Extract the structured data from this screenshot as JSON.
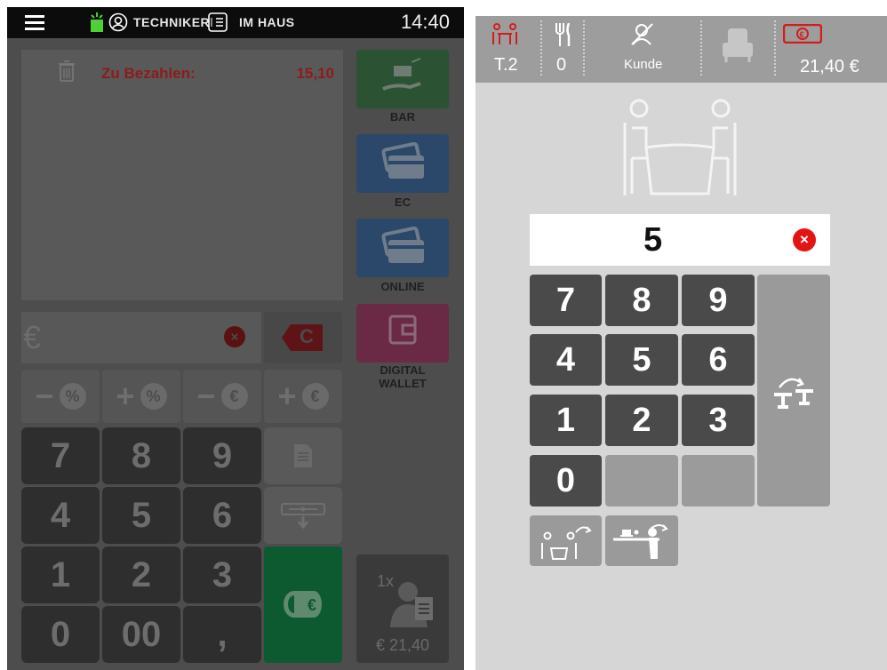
{
  "topbar": {
    "user_label": "TECHNIKER",
    "location_label": "IM HAUS",
    "time": "14:40",
    "icons": [
      "menu-icon",
      "alarm-icon",
      "user-icon",
      "list-icon"
    ]
  },
  "payment": {
    "due_label": "Zu Bezahlen:",
    "due_value": "15,10",
    "currency_symbol": "€",
    "clear_label": "C",
    "methods": [
      {
        "label": "BAR",
        "color": "#2a5e36",
        "icon": "cash-hand-icon"
      },
      {
        "label": "EC",
        "color": "#2b4d77",
        "icon": "card-icon"
      },
      {
        "label": "ONLINE",
        "color": "#2b4d77",
        "icon": "card-icon"
      },
      {
        "label": "DIGITAL WALLET",
        "color": "#7b2a4d",
        "icon": "wallet-icon"
      }
    ],
    "modifiers": [
      "%",
      "%",
      "€",
      "€"
    ],
    "modifier_signs": [
      "−",
      "+",
      "−",
      "+"
    ],
    "keys": [
      "7",
      "8",
      "9",
      "4",
      "5",
      "6",
      "1",
      "2",
      "3",
      "0",
      "00",
      ","
    ],
    "customer_count": "1x",
    "customer_total": "€ 21,40",
    "colors": {
      "due": "#b11b1b",
      "pay_green": "#0e6c3a",
      "clear_red": "#a3161b"
    }
  },
  "header": {
    "table": "T.2",
    "guests": "0",
    "customer": "Kunde",
    "amount": "21,40 €",
    "colors": {
      "accent": "#d31d1d"
    }
  },
  "entry": {
    "value": "5"
  },
  "numpad": {
    "keys": [
      "7",
      "8",
      "9",
      "4",
      "5",
      "6",
      "1",
      "2",
      "3",
      "0"
    ]
  }
}
